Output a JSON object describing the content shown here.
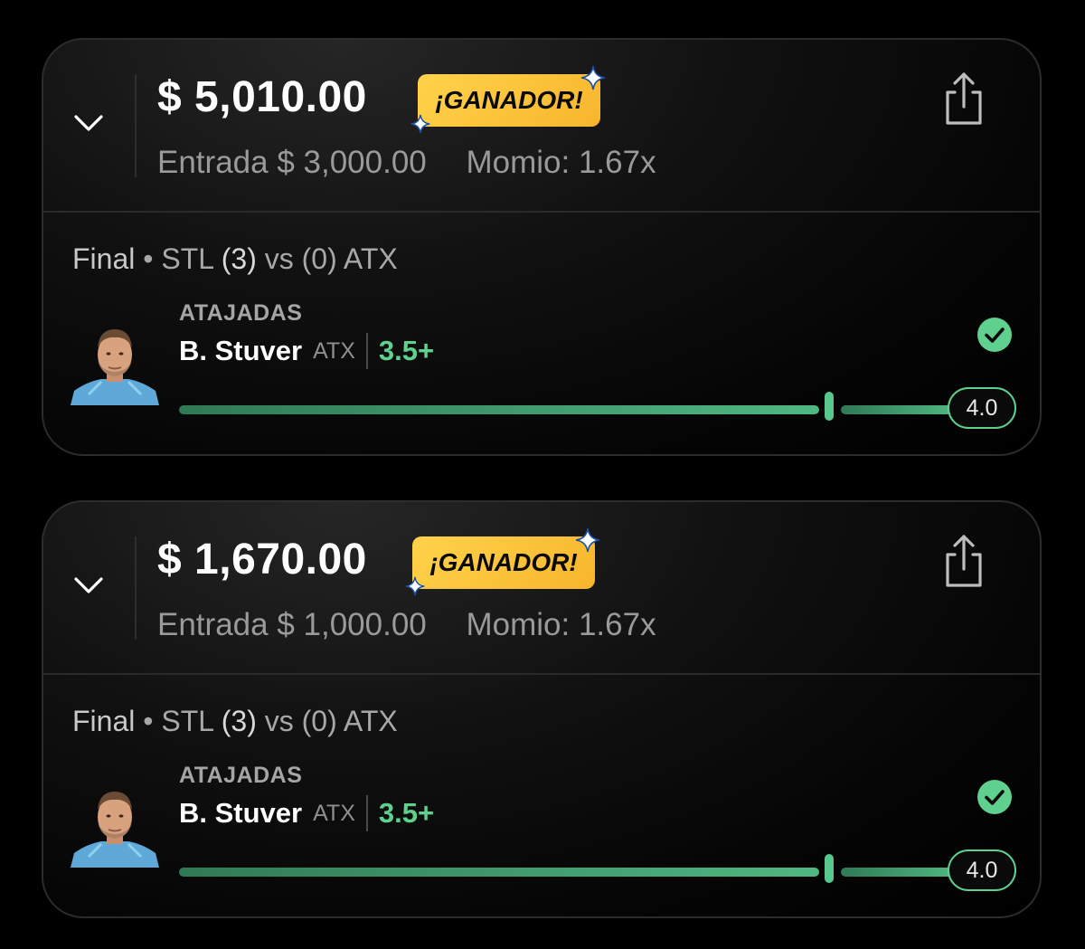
{
  "colors": {
    "background": "#000000",
    "card_border": "#2c2c2c",
    "badge_yellow": "#f7b52c",
    "accent_green": "#5fd08e",
    "muted_text": "#9a9a9a"
  },
  "icons": {
    "expand": "chevron-down-icon",
    "share": "share-icon",
    "success": "check-circle-icon",
    "sparkle": "sparkle-icon"
  },
  "bets": [
    {
      "payout": "$ 5,010.00",
      "badge": "¡GANADOR!",
      "entry_label": "Entrada",
      "entry_amount": "$ 3,000.00",
      "odds": "Momio: 1.67x",
      "match": {
        "status": "Final",
        "separator": " • ",
        "home_team": "STL",
        "home_score": "(3)",
        "vs": "vs",
        "away_score": "(0)",
        "away_team": "ATX"
      },
      "pick": {
        "stat": "ATAJADAS",
        "player": "B. Stuver",
        "team": "ATX",
        "line": "3.5+",
        "line_value": 3.5,
        "result": "4.0",
        "result_value": 4.0,
        "won": true
      }
    },
    {
      "payout": "$ 1,670.00",
      "badge": "¡GANADOR!",
      "entry_label": "Entrada",
      "entry_amount": "$ 1,000.00",
      "odds": "Momio: 1.67x",
      "match": {
        "status": "Final",
        "separator": " • ",
        "home_team": "STL",
        "home_score": "(3)",
        "vs": "vs",
        "away_score": "(0)",
        "away_team": "ATX"
      },
      "pick": {
        "stat": "ATAJADAS",
        "player": "B. Stuver",
        "team": "ATX",
        "line": "3.5+",
        "line_value": 3.5,
        "result": "4.0",
        "result_value": 4.0,
        "won": true
      }
    }
  ]
}
